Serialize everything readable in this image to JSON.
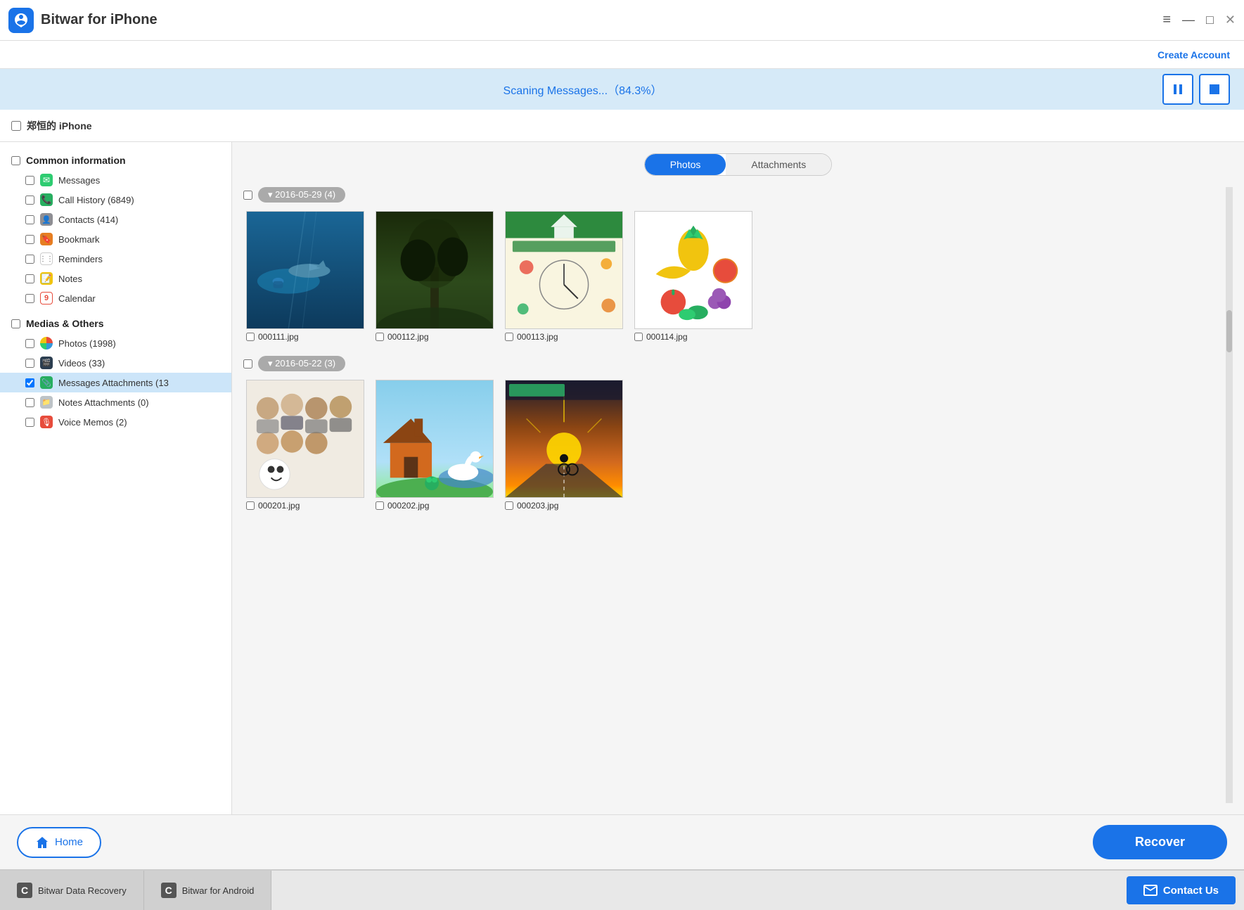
{
  "app": {
    "title": "Bitwar for iPhone",
    "logo_color": "#1a73e8"
  },
  "header": {
    "create_account_label": "Create Account"
  },
  "scan": {
    "status_text": "Scaning Messages...（84.3%）",
    "pause_label": "⏸",
    "stop_label": "⏹"
  },
  "device": {
    "name": "郑恒的 iPhone"
  },
  "sidebar": {
    "common_section": "Common information",
    "items_common": [
      {
        "label": "Messages",
        "icon": "message",
        "color": "green"
      },
      {
        "label": "Call History (6849)",
        "icon": "phone",
        "color": "green2"
      },
      {
        "label": "Contacts (414)",
        "icon": "person",
        "color": "gray"
      },
      {
        "label": "Bookmark",
        "icon": "bookmark",
        "color": "orange"
      },
      {
        "label": "Reminders",
        "icon": "list",
        "color": "white-border"
      },
      {
        "label": "Notes",
        "icon": "note",
        "color": "yellow"
      },
      {
        "label": "Calendar",
        "icon": "9",
        "color": "red"
      }
    ],
    "medias_section": "Medias & Others",
    "items_medias": [
      {
        "label": "Photos (1998)",
        "icon": "pinwheel",
        "color": "colorful",
        "active": false
      },
      {
        "label": "Videos (33)",
        "icon": "film",
        "color": "film",
        "active": false
      },
      {
        "label": "Messages Attachments (13",
        "icon": "clip",
        "color": "blue",
        "active": true
      },
      {
        "label": "Notes Attachments (0)",
        "icon": "folder",
        "color": "folder",
        "active": false
      },
      {
        "label": "Voice Memos (2)",
        "icon": "mic",
        "color": "red",
        "active": false
      }
    ]
  },
  "content": {
    "tab_photos": "Photos",
    "tab_attachments": "Attachments",
    "active_tab": "photos",
    "date_groups": [
      {
        "date_label": "2016-05-29 (4)",
        "photos": [
          {
            "filename": "000111.jpg",
            "type": "ocean"
          },
          {
            "filename": "000112.jpg",
            "type": "tree"
          },
          {
            "filename": "000113.jpg",
            "type": "poster1"
          },
          {
            "filename": "000114.jpg",
            "type": "fruits"
          }
        ]
      },
      {
        "date_label": "2016-05-22 (3)",
        "photos": [
          {
            "filename": "000201.jpg",
            "type": "group"
          },
          {
            "filename": "000202.jpg",
            "type": "swan"
          },
          {
            "filename": "000203.jpg",
            "type": "sunset"
          }
        ]
      }
    ]
  },
  "bottom": {
    "home_label": "Home",
    "recover_label": "Recover"
  },
  "footer": {
    "tab1_label": "Bitwar Data Recovery",
    "tab2_label": "Bitwar for Android",
    "contact_label": "Contact Us"
  }
}
